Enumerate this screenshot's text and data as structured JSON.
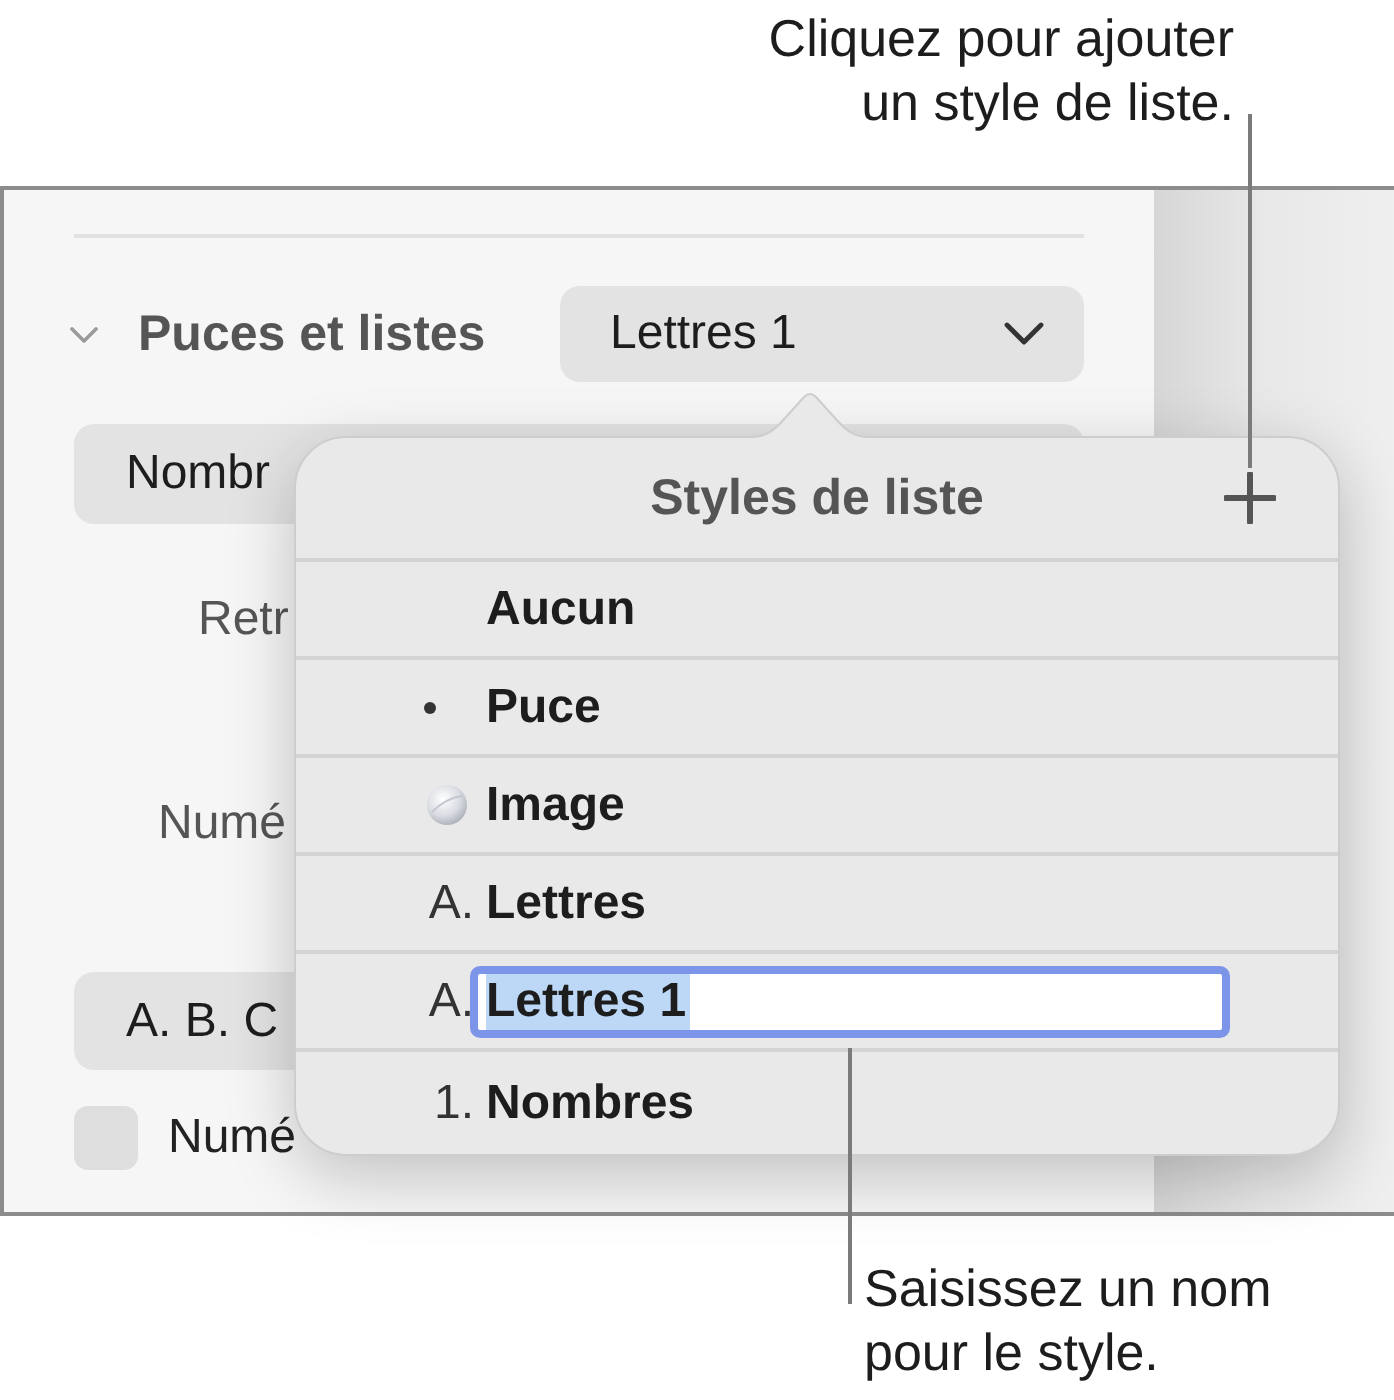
{
  "callouts": [
    {
      "kind": "top",
      "text": "Cliquez pour ajouter un style de liste."
    },
    {
      "kind": "bottom",
      "text": "Saisissez un nom pour le style."
    }
  ],
  "panel": {
    "section": {
      "title": "Puces et listes",
      "expanded": true,
      "style_popup": "Lettres 1"
    },
    "rows": [
      {
        "kind": "popup",
        "label": "Nombr"
      },
      {
        "kind": "label",
        "label": "Retr"
      },
      {
        "kind": "label",
        "label": "Numé"
      },
      {
        "kind": "popup",
        "label": "A. B. C"
      },
      {
        "kind": "checkbox",
        "label": "Numé",
        "checked": false
      }
    ]
  },
  "popover": {
    "title": "Styles de liste",
    "items": [
      {
        "kind": "none",
        "name": "Aucun",
        "editing": false
      },
      {
        "kind": "bullet",
        "name": "Puce",
        "editing": false
      },
      {
        "kind": "image",
        "name": "Image",
        "editing": false
      },
      {
        "kind": "label",
        "marker": "A.",
        "name": "Lettres",
        "editing": false
      },
      {
        "kind": "label",
        "marker": "A.",
        "name": "Lettres 1",
        "editing": true
      },
      {
        "kind": "label",
        "marker": "1.",
        "name": "Nombres",
        "editing": false
      }
    ]
  }
}
